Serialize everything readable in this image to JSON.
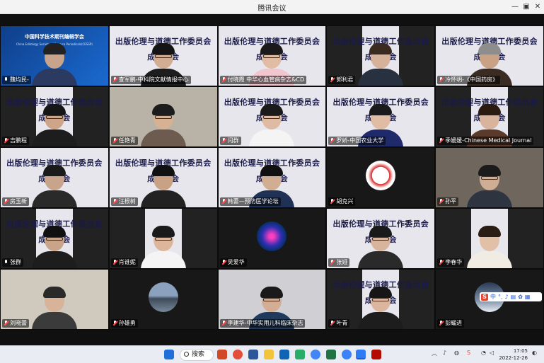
{
  "window": {
    "title": "腾讯会议"
  },
  "banner": {
    "line1": "出版伦理与道德工作委员会",
    "line2": "成立大会"
  },
  "participants": [
    {
      "name": "魏均民-",
      "mic": "on"
    },
    {
      "name": "查军鹏-中科院文献情报中心",
      "mic": "off"
    },
    {
      "name": "付晓霞 中华心血管病杂志&CD",
      "mic": "off"
    },
    {
      "name": "郭利君",
      "mic": "off"
    },
    {
      "name": "冷怀明-《中国药房》",
      "mic": "off"
    },
    {
      "name": "吉鹏程",
      "mic": "off"
    },
    {
      "name": "任艳青",
      "mic": "off"
    },
    {
      "name": "闫群",
      "mic": "off"
    },
    {
      "name": "罗娇-中国农业大学",
      "mic": "off"
    },
    {
      "name": "季媛媛-Chinese Medical Journal",
      "mic": "off"
    },
    {
      "name": "房玉新",
      "mic": "off"
    },
    {
      "name": "汪根树",
      "mic": "off"
    },
    {
      "name": "韩蕾—预防医学论坛",
      "mic": "off"
    },
    {
      "name": "胡克兴",
      "mic": "off"
    },
    {
      "name": "孙平",
      "mic": "off"
    },
    {
      "name": "张群",
      "mic": "on"
    },
    {
      "name": "肖谁妮",
      "mic": "off"
    },
    {
      "name": "吴爱华",
      "mic": "off"
    },
    {
      "name": "张娅",
      "mic": "off"
    },
    {
      "name": "李春华",
      "mic": "off"
    },
    {
      "name": "刘晓蕾",
      "mic": "off"
    },
    {
      "name": "孙雄勇",
      "mic": "off"
    },
    {
      "name": "李建华-中华实用儿科临床杂志",
      "mic": "off"
    },
    {
      "name": "叶青",
      "mic": "off"
    },
    {
      "name": "彭耀进",
      "mic": "off"
    }
  ],
  "first_tile_logo": {
    "cn": "中国科学技术期刊编辑学会",
    "en": "China Editology Society of Science Periodicals(CESSP)"
  },
  "ime": {
    "label": "中"
  },
  "taskbar": {
    "search_label": "搜索"
  },
  "clock": {
    "time": "17:05",
    "date": "2022-12-26"
  },
  "colors": {
    "titlebar": "#f3f3f3",
    "stage": "#101010",
    "banner_text": "#1a1a4a",
    "taskbar": "#e9ecf3"
  }
}
